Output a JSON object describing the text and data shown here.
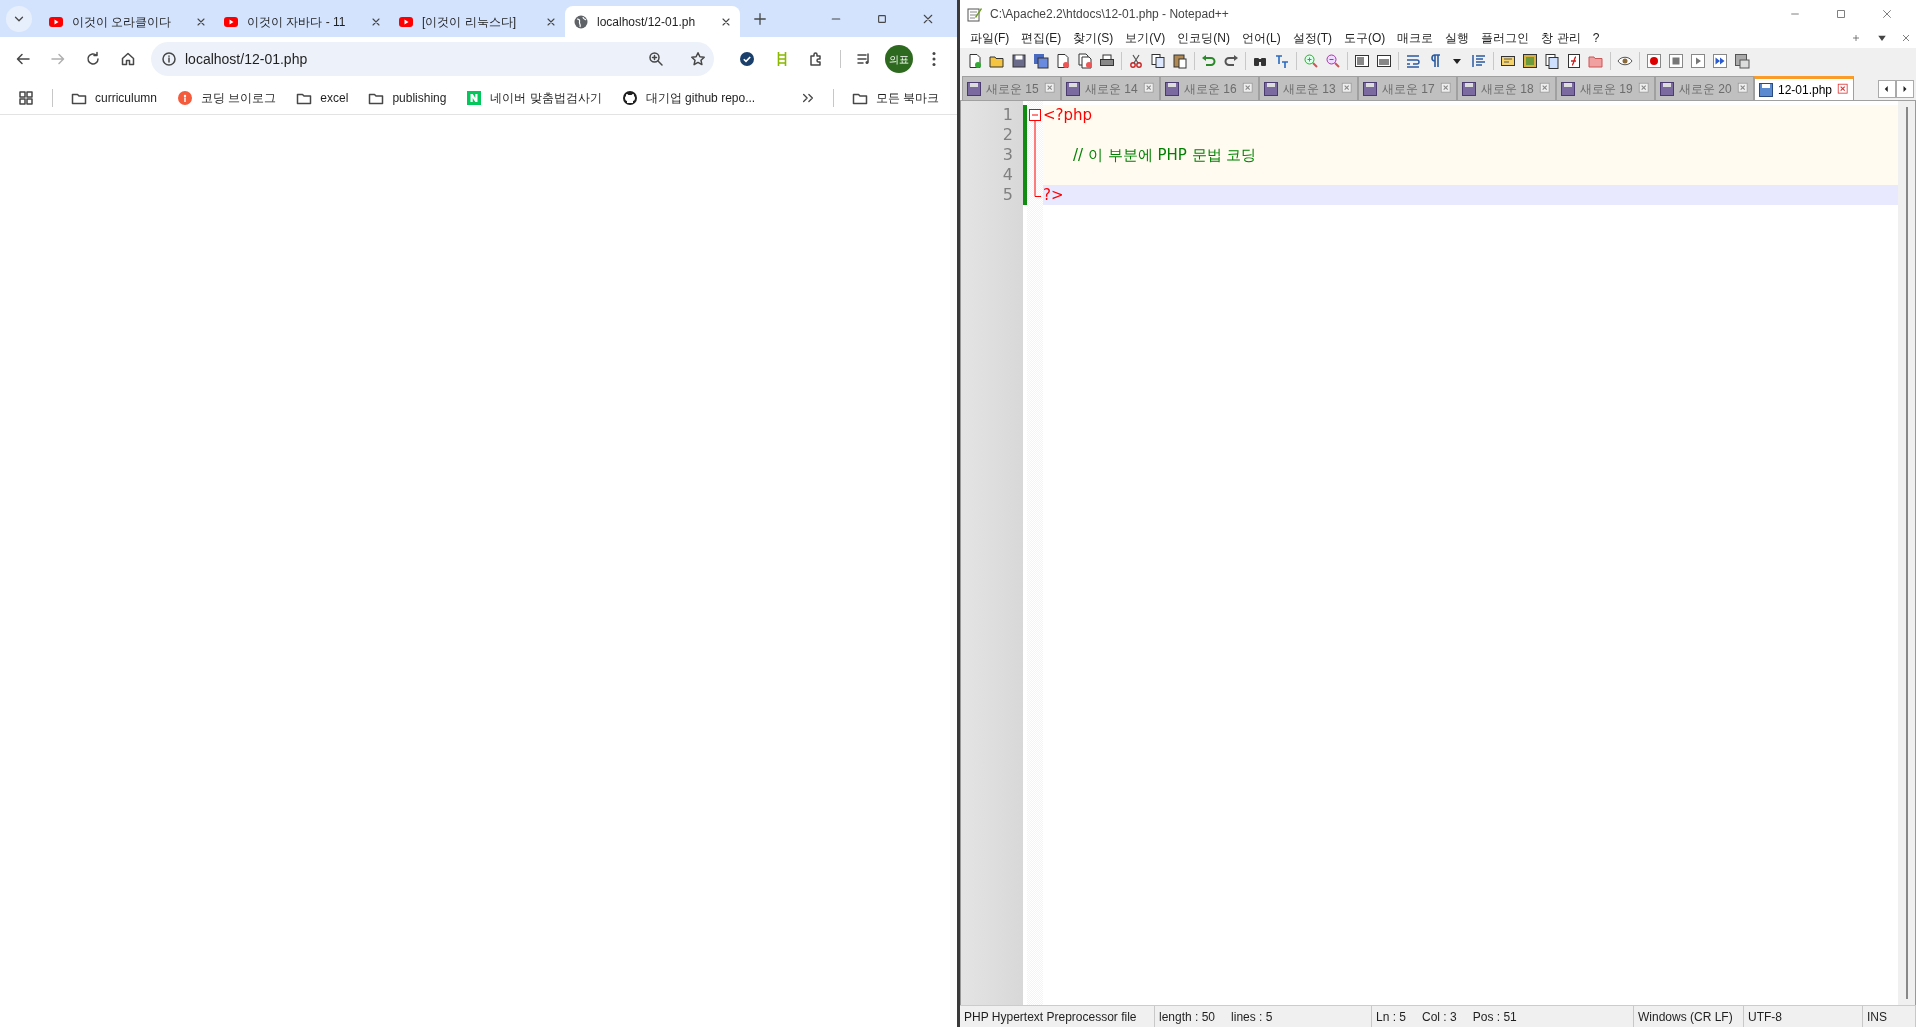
{
  "browser": {
    "tabs": [
      {
        "title": "이것이 오라클이다",
        "kind": "youtube",
        "selected": false
      },
      {
        "title": "이것이 자바다 - 11",
        "kind": "youtube",
        "selected": false
      },
      {
        "title": "[이것이 리눅스다]",
        "kind": "youtube",
        "selected": false
      },
      {
        "title": "localhost/12-01.ph",
        "kind": "globe",
        "selected": true
      }
    ],
    "address": "localhost/12-01.php",
    "profile": "의표",
    "bookmarks": [
      {
        "label": "curriculumn",
        "kind": "folder"
      },
      {
        "label": "코딩 브이로그",
        "kind": "site"
      },
      {
        "label": "excel",
        "kind": "folder"
      },
      {
        "label": "publishing",
        "kind": "folder"
      },
      {
        "label": "네이버 맞춤법검사기",
        "kind": "naver"
      },
      {
        "label": "대기업 github repo...",
        "kind": "github"
      }
    ],
    "other_bookmarks": "모든 북마크"
  },
  "editor": {
    "title": "C:\\Apache2.2\\htdocs\\12-01.php - Notepad++",
    "menu": [
      "파일(F)",
      "편집(E)",
      "찾기(S)",
      "보기(V)",
      "인코딩(N)",
      "언어(L)",
      "설정(T)",
      "도구(O)",
      "매크로",
      "실행",
      "플러그인",
      "창 관리",
      "?"
    ],
    "tabs": [
      {
        "label": "새로운 15",
        "selected": false
      },
      {
        "label": "새로운 14",
        "selected": false
      },
      {
        "label": "새로운 16",
        "selected": false
      },
      {
        "label": "새로운 13",
        "selected": false
      },
      {
        "label": "새로운 17",
        "selected": false
      },
      {
        "label": "새로운 18",
        "selected": false
      },
      {
        "label": "새로운 19",
        "selected": false
      },
      {
        "label": "새로운 20",
        "selected": false
      },
      {
        "label": "12-01.php",
        "selected": true
      }
    ],
    "lines": [
      {
        "number": "1",
        "text": "<?php",
        "kind": "tag",
        "current": false
      },
      {
        "number": "2",
        "kind": "blank",
        "current": false
      },
      {
        "number": "3",
        "text": "// 이 부분에 PHP 문법 코딩",
        "kind": "comment",
        "current": false
      },
      {
        "number": "4",
        "kind": "blank",
        "current": false
      },
      {
        "number": "5",
        "text": "?>",
        "kind": "tag",
        "current": true
      }
    ],
    "status_bar": [
      "PHP Hypertext Preprocessor file",
      "length : 50",
      "lines : 5",
      "Ln : 5",
      "Col : 3",
      "Pos : 51",
      "Windows (CR LF)",
      "UTF-8",
      "INS"
    ]
  }
}
